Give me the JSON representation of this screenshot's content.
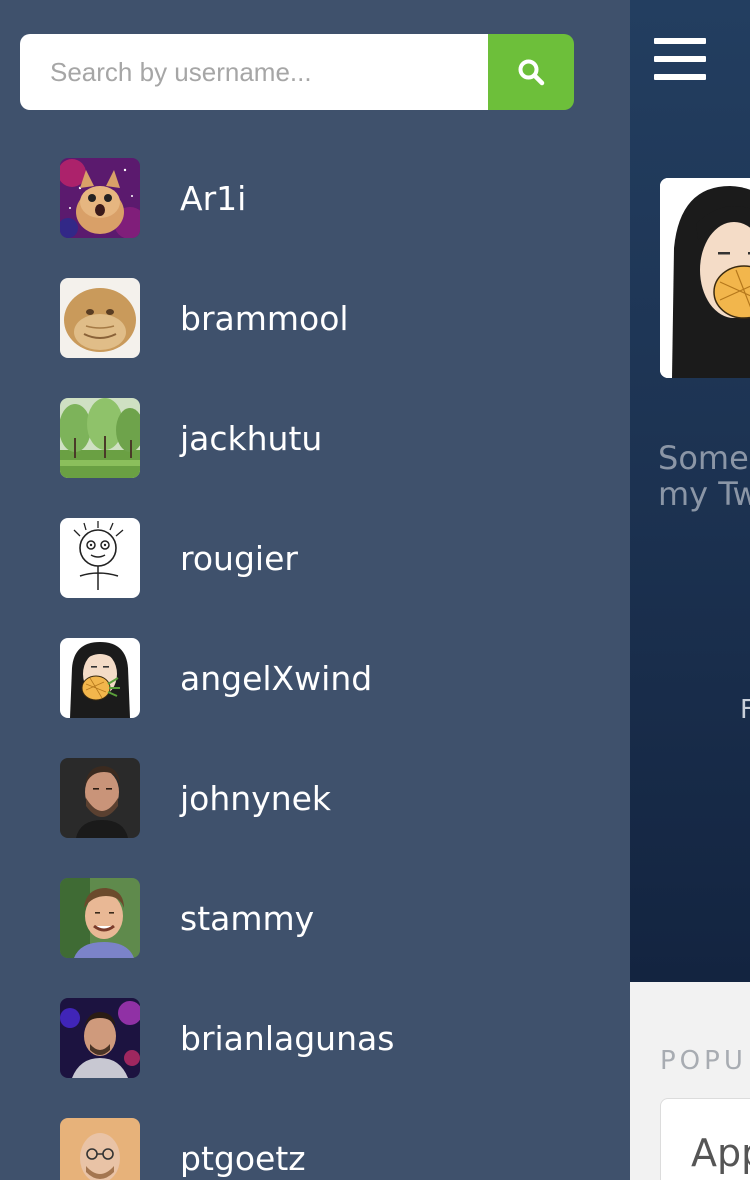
{
  "search": {
    "placeholder": "Search by username...",
    "button_icon": "search-icon"
  },
  "users": [
    {
      "username": "Ar1i",
      "avatar": "space-cat-avatar"
    },
    {
      "username": "brammool",
      "avatar": "plush-monkey-avatar"
    },
    {
      "username": "jackhutu",
      "avatar": "trees-park-avatar"
    },
    {
      "username": "rougier",
      "avatar": "doodle-face-avatar"
    },
    {
      "username": "angelXwind",
      "avatar": "girl-pineapple-avatar"
    },
    {
      "username": "johnynek",
      "avatar": "bearded-man-avatar"
    },
    {
      "username": "stammy",
      "avatar": "smiling-man-avatar"
    },
    {
      "username": "brianlagunas",
      "avatar": "man-purple-lights-avatar"
    },
    {
      "username": "ptgoetz",
      "avatar": "bald-man-glasses-avatar"
    }
  ],
  "main": {
    "menu_icon": "hamburger-menu-icon",
    "bio_line1": "Some",
    "bio_line2": "my Tw",
    "stat_letter": "F",
    "section_title": "POPU",
    "card_title": "App"
  },
  "colors": {
    "drawer_bg": "#3f516c",
    "search_button": "#6dbf3a",
    "hero_top": "#233e60",
    "hero_bottom": "#132440"
  }
}
